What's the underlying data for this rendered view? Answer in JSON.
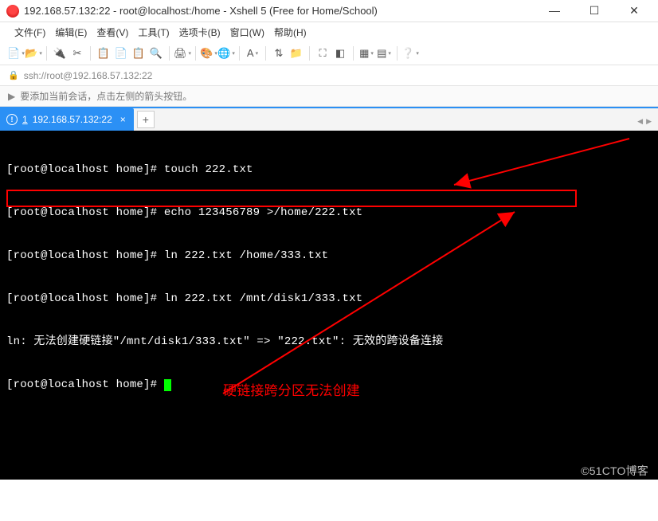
{
  "window": {
    "title": "192.168.57.132:22 - root@localhost:/home - Xshell 5 (Free for Home/School)"
  },
  "menu": {
    "file": "文件(F)",
    "edit": "编辑(E)",
    "view": "查看(V)",
    "tools": "工具(T)",
    "tabs": "选项卡(B)",
    "window": "窗口(W)",
    "help": "帮助(H)"
  },
  "address": {
    "url": "ssh://root@192.168.57.132:22"
  },
  "hint": {
    "text": "要添加当前会话，点击左侧的箭头按钮。"
  },
  "tab": {
    "num": "1",
    "label": "192.168.57.132:22"
  },
  "terminal": {
    "l1_prompt": "[root@localhost home]# ",
    "l1_cmd": "touch 222.txt",
    "l2_prompt": "[root@localhost home]# ",
    "l2_cmd": "echo 123456789 >/home/222.txt",
    "l3_prompt": "[root@localhost home]# ",
    "l3_cmd": "ln 222.txt /home/333.txt",
    "l4_prompt": "[root@localhost home]# ",
    "l4_cmd": "ln 222.txt /mnt/disk1/333.txt",
    "l5_err": "ln: 无法创建硬链接\"/mnt/disk1/333.txt\" => \"222.txt\": 无效的跨设备连接",
    "l6_prompt": "[root@localhost home]# "
  },
  "annotation": {
    "text": "硬链接跨分区无法创建"
  },
  "watermark": {
    "text": "©51CTO博客"
  }
}
